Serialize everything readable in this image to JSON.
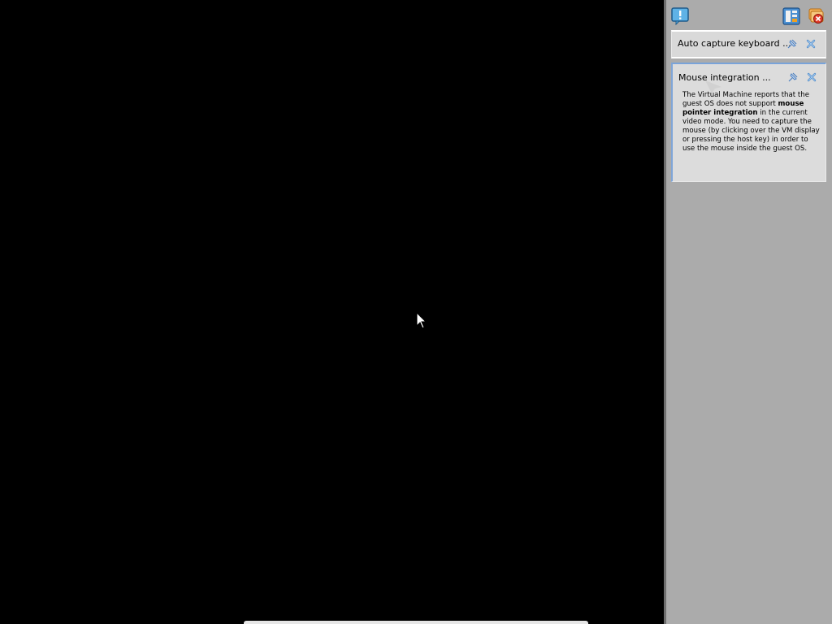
{
  "vm_display": {
    "background": "#000000"
  },
  "notification_center": {
    "toolbar": {
      "left_icon": "notification-center-icon",
      "right_icons": [
        "toggle-sort-order-icon",
        "close-all-icon"
      ]
    },
    "notifications": [
      {
        "title": "Auto capture keyboard ...",
        "pin_icon": "pin-icon",
        "close_icon": "close-icon"
      },
      {
        "title": "Mouse integration ...",
        "pin_icon": "pin-icon",
        "close_icon": "close-icon",
        "body": {
          "part1": "The Virtual Machine reports that the guest OS does not support ",
          "bold1": "mouse pointer integration",
          "part2": " in the current video mode. You need to capture the mouse (by clicking over the VM display or pressing the host key) in order to use the mouse inside the guest OS."
        }
      }
    ],
    "colors": {
      "panel_bg": "#ababab",
      "card_bg": "#d9d9d9",
      "active_border": "#79a3d9"
    }
  }
}
